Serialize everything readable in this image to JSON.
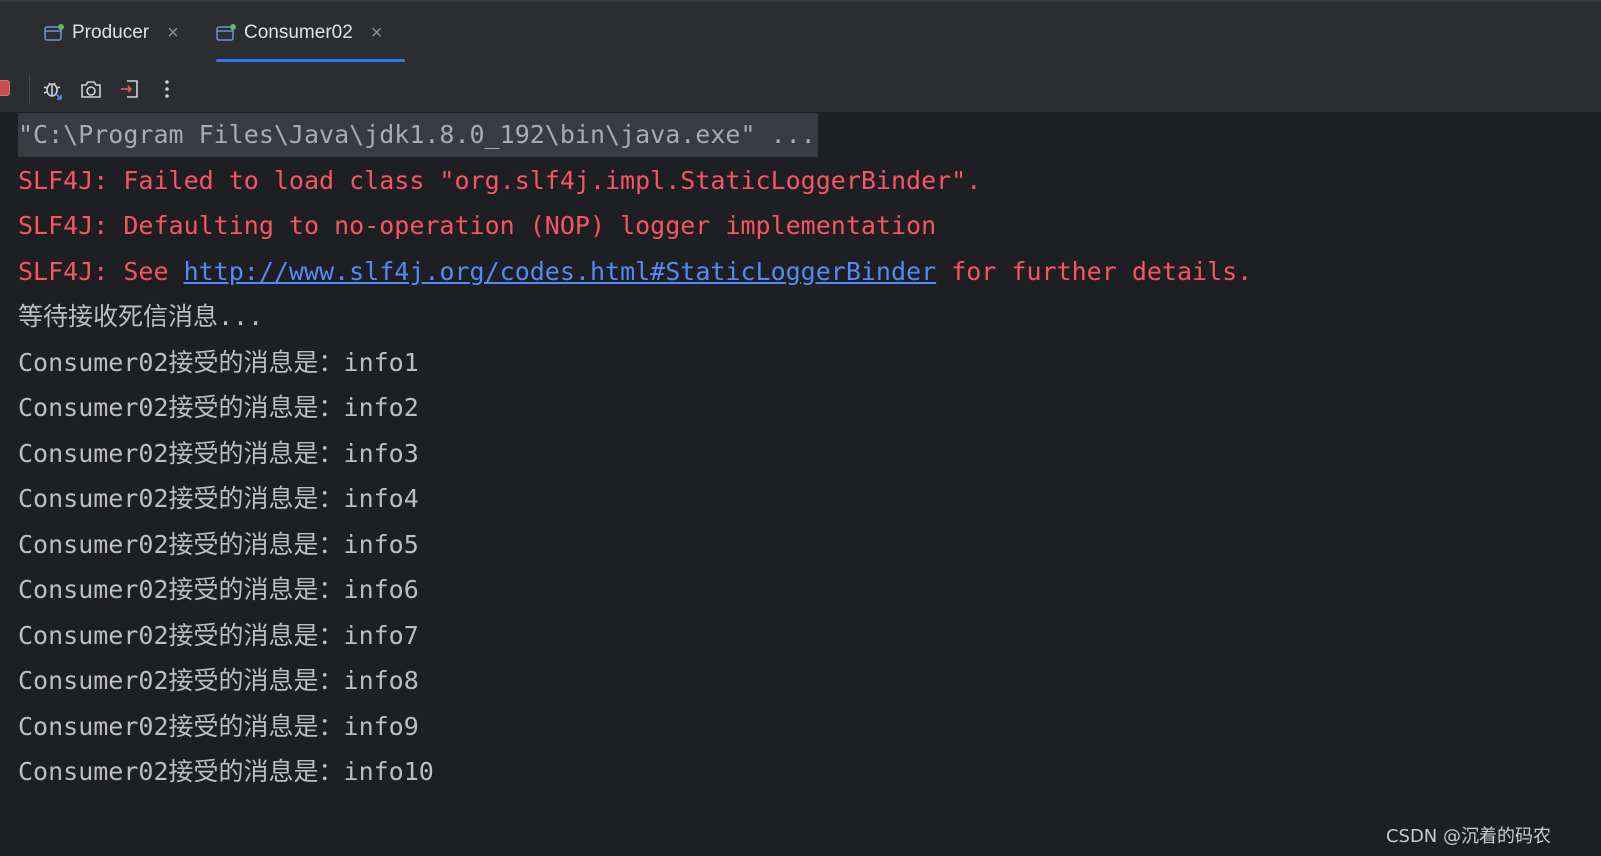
{
  "tabs": [
    {
      "label": "Producer",
      "active": false
    },
    {
      "label": "Consumer02",
      "active": true
    }
  ],
  "tab_close_glyph": "×",
  "toolbar": {
    "icons": [
      "stop-icon",
      "debug-rerun-icon",
      "screenshot-icon",
      "exit-icon",
      "more-vertical-icon"
    ]
  },
  "console": {
    "command": "\"C:\\Program Files\\Java\\jdk1.8.0_192\\bin\\java.exe\" ...",
    "errors": {
      "line1": "SLF4J: Failed to load class \"org.slf4j.impl.StaticLoggerBinder\".",
      "line2": "SLF4J: Defaulting to no-operation (NOP) logger implementation",
      "line3_prefix": "SLF4J: See ",
      "line3_link": "http://www.slf4j.org/codes.html#StaticLoggerBinder",
      "line3_suffix": " for further details."
    },
    "waiting": "等待接收死信消息...",
    "messages": [
      "Consumer02接受的消息是：info1",
      "Consumer02接受的消息是：info2",
      "Consumer02接受的消息是：info3",
      "Consumer02接受的消息是：info4",
      "Consumer02接受的消息是：info5",
      "Consumer02接受的消息是：info6",
      "Consumer02接受的消息是：info7",
      "Consumer02接受的消息是：info8",
      "Consumer02接受的消息是：info9",
      "Consumer02接受的消息是：info10"
    ]
  },
  "watermark": "CSDN @沉着的码农",
  "colors": {
    "accent": "#3574f0",
    "error": "#f75464",
    "link": "#548af7",
    "background": "#1e1f22",
    "panel": "#2b2d30",
    "run_indicator": "#5fb865"
  }
}
